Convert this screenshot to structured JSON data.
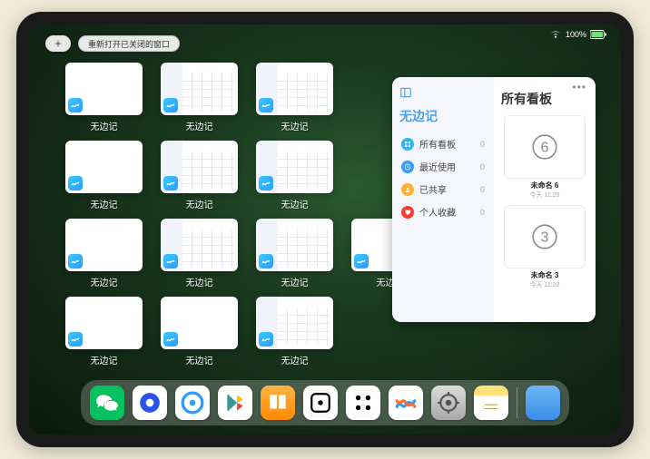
{
  "status": {
    "battery": "100%",
    "wifi": true
  },
  "topbar": {
    "plus": "+",
    "reopen_label": "重新打开已关闭的窗口"
  },
  "app_thumb_label": "无边记",
  "windows": [
    {
      "style": "blank"
    },
    {
      "style": "content"
    },
    {
      "style": "content"
    },
    null,
    {
      "style": "blank"
    },
    {
      "style": "content"
    },
    {
      "style": "content"
    },
    null,
    {
      "style": "blank"
    },
    {
      "style": "content"
    },
    {
      "style": "content"
    },
    {
      "style": "blank"
    },
    {
      "style": "blank"
    },
    {
      "style": "blank"
    },
    {
      "style": "content"
    },
    null
  ],
  "panel": {
    "left_title": "无边记",
    "right_title": "所有看板",
    "menu": [
      {
        "label": "所有看板",
        "count": 0,
        "color": "#2db6f5",
        "icon": "grid"
      },
      {
        "label": "最近使用",
        "count": 0,
        "color": "#3a9bff",
        "icon": "clock"
      },
      {
        "label": "已共享",
        "count": 0,
        "color": "#ffb02e",
        "icon": "people"
      },
      {
        "label": "个人收藏",
        "count": 0,
        "color": "#ff3b30",
        "icon": "heart"
      }
    ],
    "boards": [
      {
        "name": "未命名 6",
        "sub": "今天 11:29",
        "glyph": "6"
      },
      {
        "name": "未命名 3",
        "sub": "今天 11:28",
        "glyph": "3"
      }
    ]
  },
  "dock": [
    {
      "id": "wechat",
      "name": "微信"
    },
    {
      "id": "qvideo",
      "name": "腾讯视频"
    },
    {
      "id": "qq",
      "name": "QQ浏览器"
    },
    {
      "id": "play",
      "name": "应用商店"
    },
    {
      "id": "books",
      "name": "图书"
    },
    {
      "id": "dice",
      "name": "游戏"
    },
    {
      "id": "dots",
      "name": "应用"
    },
    {
      "id": "freeform",
      "name": "无边记"
    },
    {
      "id": "settings",
      "name": "设置"
    },
    {
      "id": "notes",
      "name": "备忘录"
    },
    {
      "id": "folder",
      "name": "文件夹"
    }
  ]
}
